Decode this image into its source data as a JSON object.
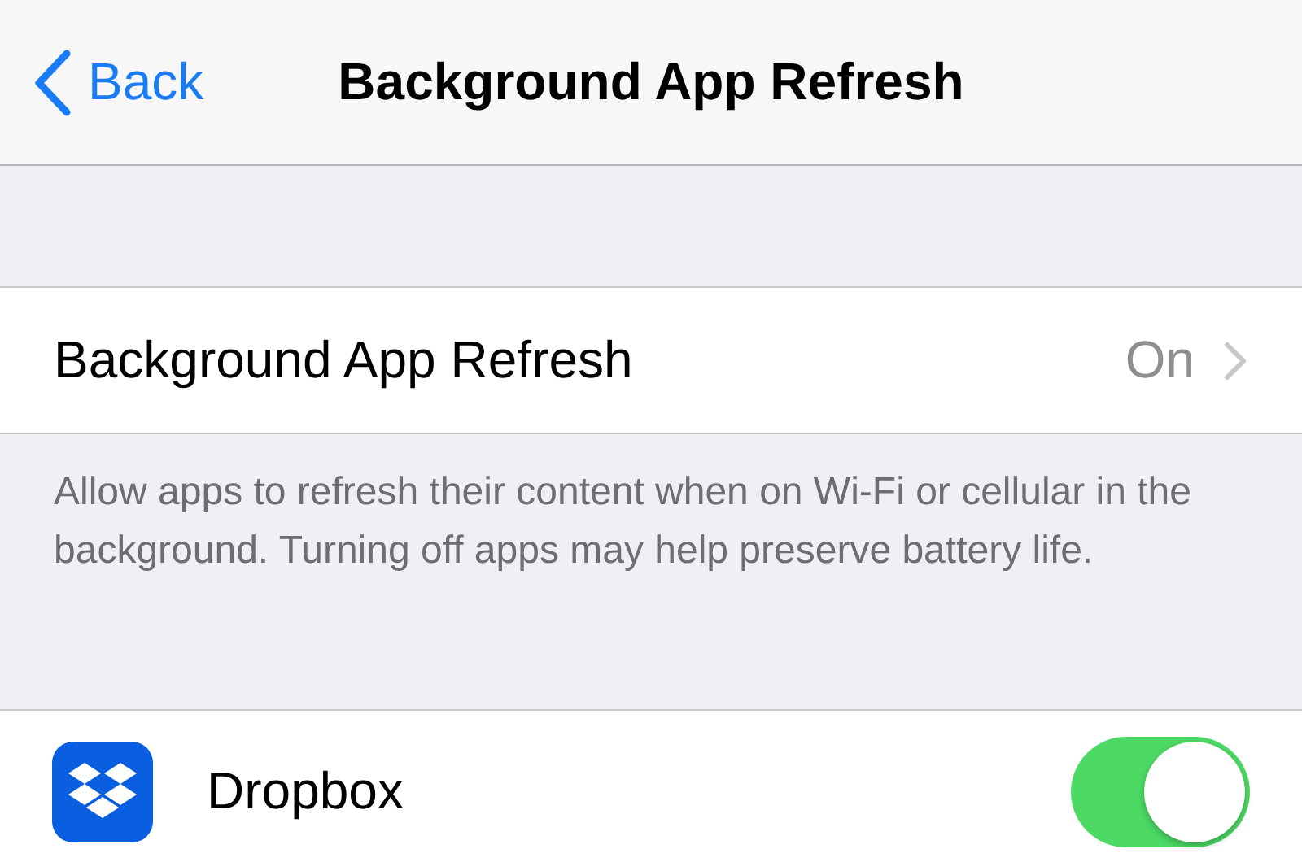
{
  "nav_bar": {
    "back_label": "Back",
    "title": "Background App Refresh"
  },
  "setting_row": {
    "label": "Background App Refresh",
    "value": "On"
  },
  "footer_note": "Allow apps to refresh their content when on Wi-Fi or cellular in the background. Turning off apps may help preserve battery life.",
  "apps": [
    {
      "name": "Dropbox",
      "on": true
    }
  ]
}
